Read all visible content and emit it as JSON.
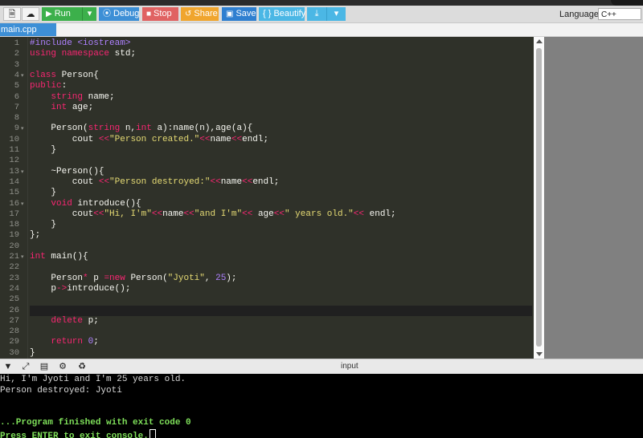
{
  "toolbar": {
    "run_label": "Run",
    "debug_label": "Debug",
    "stop_label": "Stop",
    "share_label": "Share",
    "save_label": "Save",
    "beautify_label": "{ } Beautify",
    "language_label": "Language",
    "language_value": "C++"
  },
  "tabs": [
    {
      "label": "main.cpp"
    }
  ],
  "editor": {
    "language": "cpp",
    "active_line": 26,
    "fold_lines": [
      4,
      9,
      13,
      16,
      21
    ],
    "lines": [
      "#include <iostream>",
      "using namespace std;",
      "",
      "class Person{",
      "public:",
      "    string name;",
      "    int age;",
      "",
      "    Person(string n,int a):name(n),age(a){",
      "        cout <<\"Person created.\"<<name<<endl;",
      "    }",
      "",
      "    ~Person(){",
      "        cout <<\"Person destroyed:\"<<name<<endl;",
      "    }",
      "    void introduce(){",
      "        cout<<\"Hi, I'm\"<<name<<\"and I'm\"<< age<<\" years old.\"<< endl;",
      "    }",
      "};",
      "",
      "int main(){",
      "",
      "    Person* p =new Person(\"Jyoti\", 25);",
      "    p->introduce();",
      "",
      "",
      "    delete p;",
      "",
      "    return 0;",
      "}"
    ]
  },
  "console_bar": {
    "input_label": "input"
  },
  "console": {
    "output_lines": [
      "Hi, I'm Jyoti and I'm 25 years old.",
      "Person destroyed: Jyoti",
      "",
      "",
      "...Program finished with exit code 0",
      "Press ENTER to exit console."
    ],
    "green_lines": [
      4,
      5
    ]
  },
  "colors": {
    "run": "#3cb04b",
    "debug": "#3d8fd6",
    "stop": "#e06262",
    "share": "#f0a52e",
    "save": "#2f7fd0",
    "beautify": "#4bb7e5",
    "editor_bg": "#2f3129",
    "console_bg": "#000000"
  },
  "icons": {
    "new_file": "file-icon",
    "upload": "cloud-upload-icon",
    "run": "play-icon",
    "debug": "target-icon",
    "stop": "stop-icon",
    "share": "share-icon",
    "save": "floppy-icon",
    "download": "download-icon",
    "collapse": "chevron-down-icon",
    "expand": "expand-icon",
    "console_settings": "gear-icon",
    "clear_console": "broom-icon"
  }
}
